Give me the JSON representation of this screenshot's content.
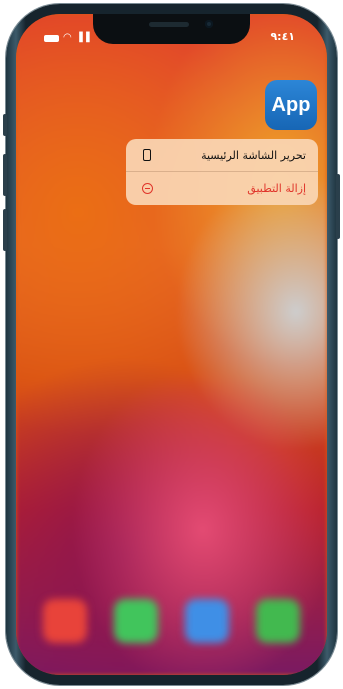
{
  "status_bar": {
    "time": "٩:٤١",
    "signal_icon": "signal-bars",
    "wifi_icon": "wifi",
    "battery_icon": "battery-full"
  },
  "app_icon": {
    "label": "App",
    "color": "#2478c8"
  },
  "context_menu": {
    "items": [
      {
        "label": "تحرير الشاشة الرئيسية",
        "icon": "phone-screen-icon",
        "color": "#111111"
      },
      {
        "label": "إزالة التطبيق",
        "icon": "minus-circle-icon",
        "color": "#e0352b"
      }
    ]
  },
  "dock": {
    "apps": [
      {
        "icon": "phone-app-icon",
        "color": "#e8433a"
      },
      {
        "icon": "messages-app-icon",
        "color": "#41c55c"
      },
      {
        "icon": "safari-app-icon",
        "color": "#3f8fe6"
      },
      {
        "icon": "music-app-icon",
        "color": "#42b94f"
      }
    ]
  }
}
